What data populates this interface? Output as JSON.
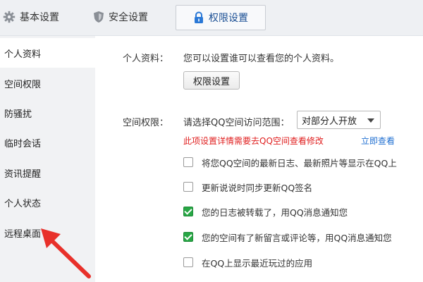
{
  "tabs": [
    {
      "label": "基本设置",
      "icon": "gear-icon"
    },
    {
      "label": "安全设置",
      "icon": "shield-icon"
    },
    {
      "label": "权限设置",
      "icon": "lock-icon",
      "active": true
    }
  ],
  "sidebar": {
    "items": [
      {
        "label": "个人资料",
        "active": true
      },
      {
        "label": "空间权限"
      },
      {
        "label": "防骚扰"
      },
      {
        "label": "临时会话"
      },
      {
        "label": "资讯提醒"
      },
      {
        "label": "个人状态"
      },
      {
        "label": "远程桌面"
      }
    ]
  },
  "profile": {
    "label": "个人资料：",
    "description": "您可以设置谁可以查看您的个人资料。",
    "button": "权限设置"
  },
  "space": {
    "label": "空间权限：",
    "range_label": "请选择QQ空间访问范围：",
    "select_value": "对部分人开放",
    "warning": "此项设置详情需要去QQ空间查看修改",
    "link": "立即查看"
  },
  "options": [
    {
      "label": "将您QQ空间的最新日志、最新照片等显示在QQ上",
      "checked": false
    },
    {
      "label": "更新说说时同步更新QQ签名",
      "checked": false
    },
    {
      "label": "您的日志被转载了，用QQ消息通知您",
      "checked": true
    },
    {
      "label": "您的空间有了新留言或评论等，用QQ消息通知您",
      "checked": true
    },
    {
      "label": "在QQ上显示最近玩过的应用",
      "checked": false
    }
  ],
  "colors": {
    "warning": "#e02020",
    "link": "#1f6fd1",
    "checkbox": "#28a745",
    "arrow": "#e8302a"
  }
}
